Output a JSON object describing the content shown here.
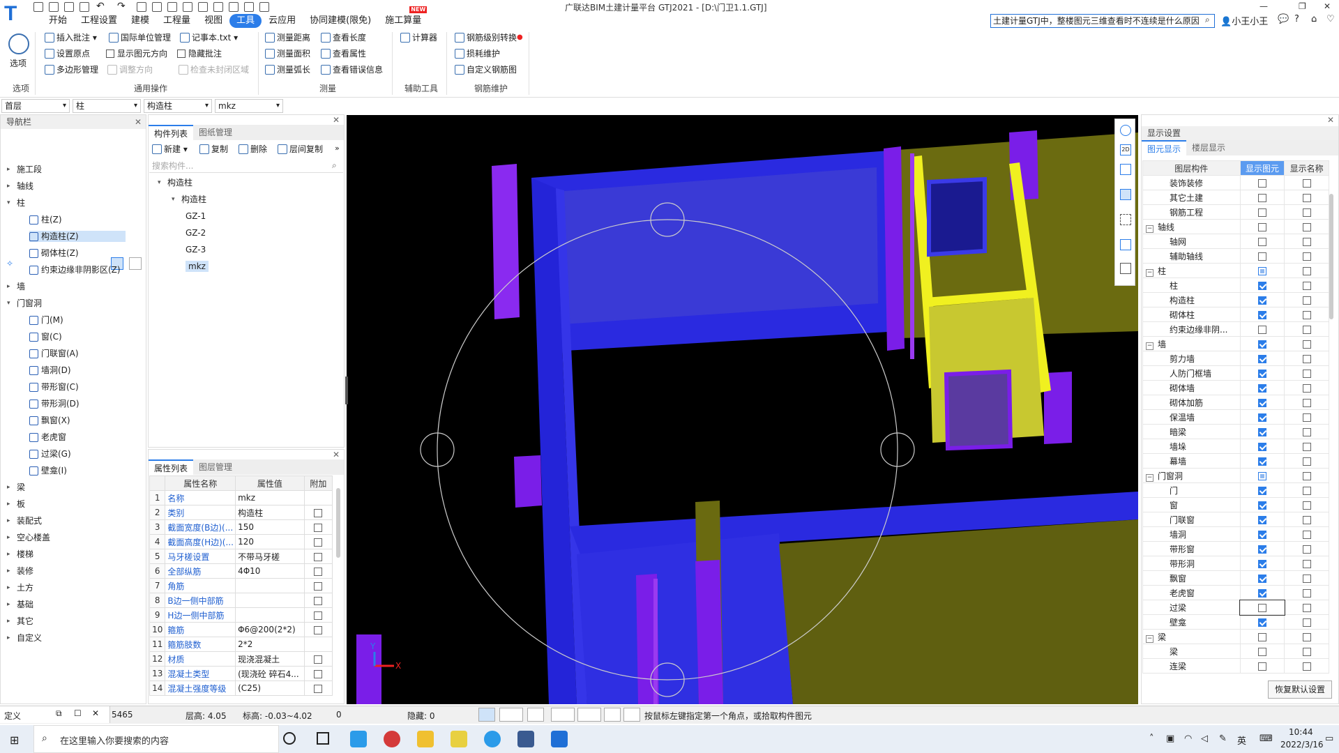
{
  "app": {
    "title": "广联达BIM土建计量平台 GTJ2021 - [D:\\门卫1.1.GTJ]",
    "logo": "T",
    "search_text": "土建计量GTJ中，整楼图元三维查看时不连续是什么原因",
    "user": "小王小王"
  },
  "menu": {
    "items": [
      "开始",
      "工程设置",
      "建模",
      "工程量",
      "视图",
      "工具",
      "云应用",
      "协同建模(限免)",
      "施工算量"
    ],
    "active": "工具",
    "new_badge": "NEW"
  },
  "ribbon": {
    "options_label": "选项",
    "general": {
      "insert_note": "插入批注",
      "intl_unit": "国际单位管理",
      "notepad": "记事本.txt",
      "set_origin": "设置原点",
      "show_dir": "显示图元方向",
      "hide_note": "隐藏批注",
      "polygon_mgr": "多边形管理",
      "adjust_dir": "调整方向",
      "check_closed": "检查未封闭区域"
    },
    "measure": {
      "distance": "测量距离",
      "length": "查看长度",
      "area": "测量面积",
      "attr": "查看属性",
      "arc": "测量弧长",
      "errors": "查看错误信息"
    },
    "aux": {
      "calculator": "计算器"
    },
    "rebar": {
      "convert": "钢筋级别转换",
      "loss": "损耗维护",
      "custom": "自定义钢筋图"
    },
    "groups": [
      "选项",
      "通用操作",
      "测量",
      "辅助工具",
      "钢筋维护"
    ]
  },
  "combos": [
    "首层",
    "柱",
    "构造柱",
    "mkz"
  ],
  "nav": {
    "title": "导航栏",
    "items": [
      {
        "label": "施工段",
        "type": "group",
        "state": "closed"
      },
      {
        "label": "轴线",
        "type": "group",
        "state": "closed"
      },
      {
        "label": "柱",
        "type": "group",
        "state": "open"
      },
      {
        "label": "柱(Z)",
        "type": "child"
      },
      {
        "label": "构造柱(Z)",
        "type": "child",
        "selected": true
      },
      {
        "label": "砌体柱(Z)",
        "type": "child"
      },
      {
        "label": "约束边缘非阴影区(Z)",
        "type": "child"
      },
      {
        "label": "墙",
        "type": "group",
        "state": "closed"
      },
      {
        "label": "门窗洞",
        "type": "group",
        "state": "open"
      },
      {
        "label": "门(M)",
        "type": "child"
      },
      {
        "label": "窗(C)",
        "type": "child"
      },
      {
        "label": "门联窗(A)",
        "type": "child"
      },
      {
        "label": "墙洞(D)",
        "type": "child"
      },
      {
        "label": "带形窗(C)",
        "type": "child"
      },
      {
        "label": "带形洞(D)",
        "type": "child"
      },
      {
        "label": "飘窗(X)",
        "type": "child"
      },
      {
        "label": "老虎窗",
        "type": "child"
      },
      {
        "label": "过梁(G)",
        "type": "child"
      },
      {
        "label": "壁龛(I)",
        "type": "child"
      },
      {
        "label": "梁",
        "type": "group",
        "state": "closed"
      },
      {
        "label": "板",
        "type": "group",
        "state": "closed"
      },
      {
        "label": "装配式",
        "type": "group",
        "state": "closed"
      },
      {
        "label": "空心楼盖",
        "type": "group",
        "state": "closed"
      },
      {
        "label": "楼梯",
        "type": "group",
        "state": "closed"
      },
      {
        "label": "装修",
        "type": "group",
        "state": "closed"
      },
      {
        "label": "土方",
        "type": "group",
        "state": "closed"
      },
      {
        "label": "基础",
        "type": "group",
        "state": "closed"
      },
      {
        "label": "其它",
        "type": "group",
        "state": "closed"
      },
      {
        "label": "自定义",
        "type": "group",
        "state": "closed"
      }
    ]
  },
  "component_list": {
    "tabs": [
      "构件列表",
      "图纸管理"
    ],
    "toolbar": {
      "new": "新建",
      "copy": "复制",
      "delete": "删除",
      "floor_copy": "层间复制"
    },
    "search_placeholder": "搜索构件...",
    "tree": [
      {
        "label": "构造柱",
        "level": 0
      },
      {
        "label": "构造柱",
        "level": 1
      },
      {
        "label": "GZ-1",
        "level": 2
      },
      {
        "label": "GZ-2",
        "level": 2
      },
      {
        "label": "GZ-3",
        "level": 2
      },
      {
        "label": "mkz",
        "level": 2,
        "selected": true
      }
    ]
  },
  "properties": {
    "tabs": [
      "属性列表",
      "图层管理"
    ],
    "headers": [
      "",
      "属性名称",
      "属性值",
      "附加"
    ],
    "rows": [
      {
        "n": "1",
        "k": "名称",
        "v": "mkz",
        "cb": false
      },
      {
        "n": "2",
        "k": "类别",
        "v": "构造柱",
        "cb": true
      },
      {
        "n": "3",
        "k": "截面宽度(B边)(...",
        "v": "150",
        "cb": true
      },
      {
        "n": "4",
        "k": "截面高度(H边)(...",
        "v": "120",
        "cb": true
      },
      {
        "n": "5",
        "k": "马牙槎设置",
        "v": "不带马牙槎",
        "cb": true
      },
      {
        "n": "6",
        "k": "全部纵筋",
        "v": "4Φ10",
        "cb": true
      },
      {
        "n": "7",
        "k": "角筋",
        "v": "",
        "cb": true
      },
      {
        "n": "8",
        "k": "B边一侧中部筋",
        "v": "",
        "cb": true
      },
      {
        "n": "9",
        "k": "H边一侧中部筋",
        "v": "",
        "cb": true
      },
      {
        "n": "10",
        "k": "箍筋",
        "v": "Φ6@200(2*2)",
        "cb": true
      },
      {
        "n": "11",
        "k": "箍筋肢数",
        "v": "2*2",
        "cb": false
      },
      {
        "n": "12",
        "k": "材质",
        "v": "现浇混凝土",
        "cb": true
      },
      {
        "n": "13",
        "k": "混凝土类型",
        "v": "(现浇砼 碎石4...",
        "cb": true
      },
      {
        "n": "14",
        "k": "混凝土强度等级",
        "v": "(C25)",
        "cb": true
      }
    ]
  },
  "display": {
    "title": "显示设置",
    "tabs": [
      "图元显示",
      "楼层显示"
    ],
    "headers": [
      "图层构件",
      "显示图元",
      "显示名称"
    ],
    "rows": [
      {
        "label": "装饰装修",
        "g": false,
        "show": "off",
        "name": "off"
      },
      {
        "label": "其它土建",
        "g": false,
        "show": "off",
        "name": "off"
      },
      {
        "label": "钢筋工程",
        "g": false,
        "show": "off",
        "name": "off"
      },
      {
        "label": "轴线",
        "g": true,
        "show": "off",
        "name": "off"
      },
      {
        "label": "轴网",
        "g": false,
        "show": "off",
        "name": "off"
      },
      {
        "label": "辅助轴线",
        "g": false,
        "show": "off",
        "name": "off"
      },
      {
        "label": "柱",
        "g": true,
        "show": "part",
        "name": "off"
      },
      {
        "label": "柱",
        "g": false,
        "show": "on",
        "name": "off"
      },
      {
        "label": "构造柱",
        "g": false,
        "show": "on",
        "name": "off"
      },
      {
        "label": "砌体柱",
        "g": false,
        "show": "on",
        "name": "off"
      },
      {
        "label": "约束边缘非阴...",
        "g": false,
        "show": "off",
        "name": "off"
      },
      {
        "label": "墙",
        "g": true,
        "show": "on",
        "name": "off"
      },
      {
        "label": "剪力墙",
        "g": false,
        "show": "on",
        "name": "off"
      },
      {
        "label": "人防门框墙",
        "g": false,
        "show": "on",
        "name": "off"
      },
      {
        "label": "砌体墙",
        "g": false,
        "show": "on",
        "name": "off"
      },
      {
        "label": "砌体加筋",
        "g": false,
        "show": "on",
        "name": "off"
      },
      {
        "label": "保温墙",
        "g": false,
        "show": "on",
        "name": "off"
      },
      {
        "label": "暗梁",
        "g": false,
        "show": "on",
        "name": "off"
      },
      {
        "label": "墙垛",
        "g": false,
        "show": "on",
        "name": "off"
      },
      {
        "label": "幕墙",
        "g": false,
        "show": "on",
        "name": "off"
      },
      {
        "label": "门窗洞",
        "g": true,
        "show": "part",
        "name": "off"
      },
      {
        "label": "门",
        "g": false,
        "show": "on",
        "name": "off"
      },
      {
        "label": "窗",
        "g": false,
        "show": "on",
        "name": "off"
      },
      {
        "label": "门联窗",
        "g": false,
        "show": "on",
        "name": "off"
      },
      {
        "label": "墙洞",
        "g": false,
        "show": "on",
        "name": "off"
      },
      {
        "label": "带形窗",
        "g": false,
        "show": "on",
        "name": "off"
      },
      {
        "label": "带形洞",
        "g": false,
        "show": "on",
        "name": "off"
      },
      {
        "label": "飘窗",
        "g": false,
        "show": "on",
        "name": "off"
      },
      {
        "label": "老虎窗",
        "g": false,
        "show": "on",
        "name": "off"
      },
      {
        "label": "过梁",
        "g": false,
        "show": "off",
        "name": "off"
      },
      {
        "label": "壁龛",
        "g": false,
        "show": "on",
        "name": "off"
      },
      {
        "label": "梁",
        "g": true,
        "show": "off",
        "name": "off"
      },
      {
        "label": "梁",
        "g": false,
        "show": "off",
        "name": "off"
      },
      {
        "label": "连梁",
        "g": false,
        "show": "off",
        "name": "off"
      }
    ],
    "restore_button": "恢复默认设置"
  },
  "status": {
    "mode": "定义",
    "coord": "5465",
    "floor_height": "层高:  4.05",
    "elevation": "标高:  -0.03~4.02",
    "zero": "0",
    "hidden": "隐藏:  0",
    "hint": "按鼠标左键指定第一个角点，或拾取构件图元"
  },
  "viewport": {
    "axis_x": "X",
    "axis_y": "Y"
  },
  "taskbar": {
    "search_placeholder": "在这里输入你要搜索的内容",
    "time": "10:44",
    "date": "2022/3/16",
    "ime": "英"
  },
  "colors": {
    "accent": "#2b7de9",
    "wall_blue": "#2a2ae0",
    "column_purple": "#7a1ee8",
    "beam_olive": "#6b6b10",
    "lintel_yellow": "#f0f020"
  }
}
